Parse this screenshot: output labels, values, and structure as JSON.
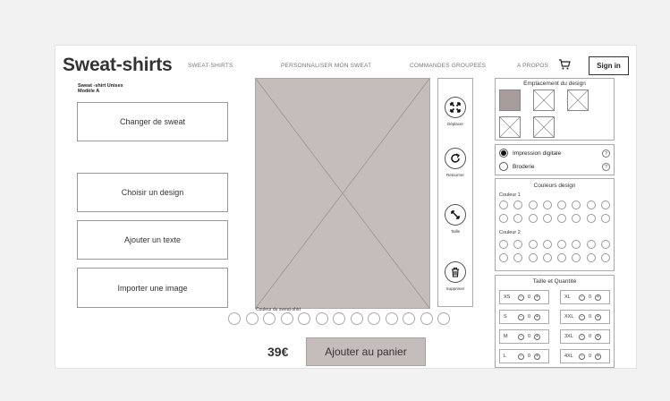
{
  "header": {
    "brand": "Sweat-shirts",
    "nav": [
      "SWEAT-SHIRTS",
      "PERSONNALISER MON SWEAT",
      "COMMANDES GROUPEES",
      "A PROPOS"
    ],
    "sign_in": "Sign in"
  },
  "product": {
    "line1": "Sweat -shirt Unisex",
    "line2": "Modèle A"
  },
  "actions": [
    "Changer de sweat",
    "Choisir un design",
    "Ajouter un texte",
    "Importer une image"
  ],
  "tools": [
    "Déplacer",
    "Retourner",
    "Taille",
    "Supprimer"
  ],
  "sweat_color": {
    "label": "Couleur du sweat-shirt"
  },
  "price": "39€",
  "add_to_cart": "Ajouter au panier",
  "design_location": {
    "title": "Emplacement du design"
  },
  "print_options": {
    "option1": "Impression digitale",
    "option2": "Broderie",
    "selected": "Impression digitale",
    "help": "?"
  },
  "design_colors": {
    "title": "Couleurs design",
    "color1": "Couleur 1",
    "color2": "Couleur 2"
  },
  "sizes": {
    "title": "Taille et Quantité",
    "items": [
      {
        "size": "XS",
        "qty": "0",
        "minus": "−",
        "plus": "+"
      },
      {
        "size": "XL",
        "qty": "0",
        "minus": "−",
        "plus": "+"
      },
      {
        "size": "S",
        "qty": "0",
        "minus": "−",
        "plus": "+"
      },
      {
        "size": "XXL",
        "qty": "0",
        "minus": "−",
        "plus": "+"
      },
      {
        "size": "M",
        "qty": "0",
        "minus": "−",
        "plus": "+"
      },
      {
        "size": "3XL",
        "qty": "0",
        "minus": "−",
        "plus": "+"
      },
      {
        "size": "L",
        "qty": "0",
        "minus": "−",
        "plus": "+"
      },
      {
        "size": "4XL",
        "qty": "0",
        "minus": "−",
        "plus": "+"
      }
    ]
  },
  "colors": {
    "preview_fill": "#c5bcbc",
    "selected_thumb": "#a69c9c"
  }
}
